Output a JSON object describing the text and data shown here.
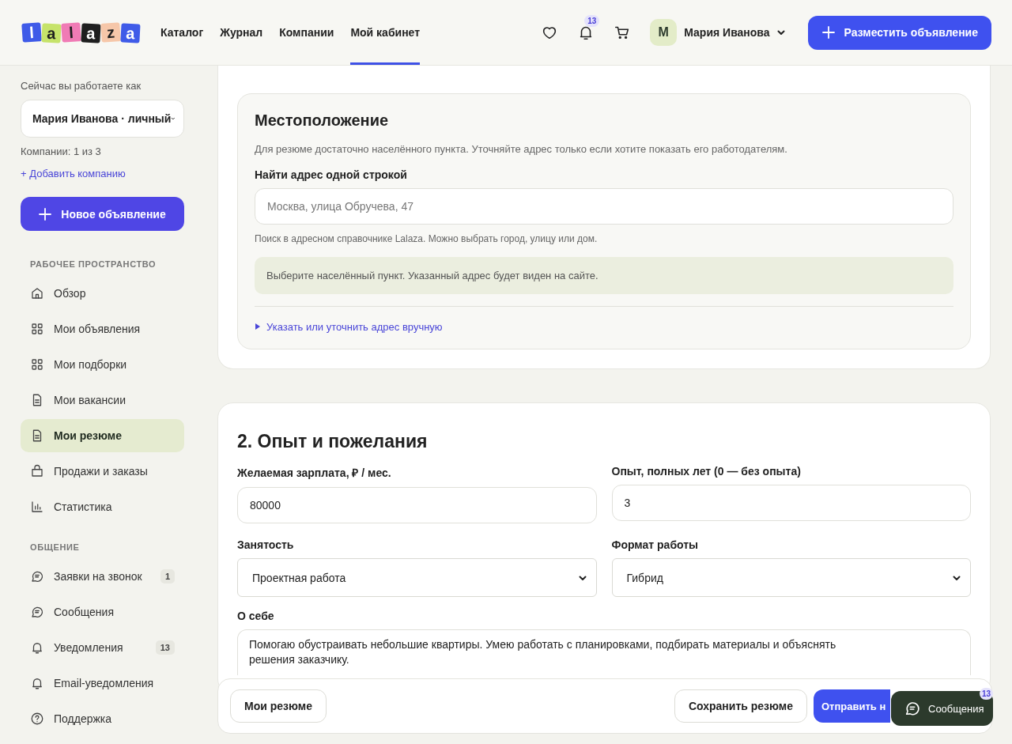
{
  "header": {
    "logo": [
      "l",
      "a",
      "l",
      "a",
      "z",
      "a"
    ],
    "nav": [
      {
        "label": "Каталог",
        "selected": false
      },
      {
        "label": "Журнал",
        "selected": false
      },
      {
        "label": "Компании",
        "selected": false
      },
      {
        "label": "Мой кабинет",
        "selected": true
      }
    ],
    "notifications_badge": "13",
    "avatar": "М",
    "user_name": "Мария Иванова",
    "post_button": "Разместить объявление"
  },
  "sidebar": {
    "working_as_label": "Сейчас вы работаете как",
    "account_select": "Мария Иванова · личный",
    "companies_count": "Компании: 1 из 3",
    "add_company_link": "+ Добавить компанию",
    "new_ad_button": "Новое объявление",
    "sections": [
      {
        "title": "РАБОЧЕЕ ПРОСТРАНСТВО",
        "items": [
          {
            "label": "Обзор",
            "selected": false
          },
          {
            "label": "Мои объявления",
            "selected": false
          },
          {
            "label": "Мои подборки",
            "selected": false
          },
          {
            "label": "Мои вакансии",
            "selected": false
          },
          {
            "label": "Мои резюме",
            "selected": true
          },
          {
            "label": "Продажи и заказы",
            "selected": false
          },
          {
            "label": "Статистика",
            "selected": false
          }
        ]
      },
      {
        "title": "ОБЩЕНИЕ",
        "items": [
          {
            "label": "Заявки на звонок",
            "selected": false,
            "badge": "1"
          },
          {
            "label": "Сообщения",
            "selected": false
          },
          {
            "label": "Уведомления",
            "selected": false,
            "badge": "13"
          },
          {
            "label": "Email-уведомления",
            "selected": false
          },
          {
            "label": "Поддержка",
            "selected": false
          }
        ]
      }
    ]
  },
  "location": {
    "title": "Местоположение",
    "description": "Для резюме достаточно населённого пункта. Уточняйте адрес только если хотите показать его работодателям.",
    "address_label": "Найти адрес одной строкой",
    "address_placeholder": "Москва, улица Обручева, 47",
    "address_hint": "Поиск в адресном справочнике Lalaza. Можно выбрать город, улицу или дом.",
    "notice": "Выберите населённый пункт. Указанный адрес будет виден на сайте.",
    "manual_toggle": {
      "label": "Указать или уточнить адрес вручную",
      "expanded": false
    }
  },
  "experience": {
    "title": "2. Опыт и пожелания",
    "fields": [
      {
        "kind": "input",
        "label": "Желаемая зарплата, ₽ / мес.",
        "value": "80000"
      },
      {
        "kind": "input",
        "label": "Опыт, полных лет (0 — без опыта)",
        "value": "3"
      },
      {
        "kind": "select",
        "label": "Занятость",
        "value": "Проектная работа"
      },
      {
        "kind": "select",
        "label": "Формат работы",
        "value": "Гибрид"
      }
    ],
    "about_label": "О себе",
    "about_value": "Помогаю обустраивать небольшие квартиры. Умею работать с планировками, подбирать материалы и объяснять решения заказчику."
  },
  "footer": {
    "back_button": "Мои резюме",
    "save_button": "Сохранить резюме",
    "submit_button": "Отправить н"
  },
  "chat_widget": {
    "label": "Сообщения",
    "badge": "13"
  }
}
